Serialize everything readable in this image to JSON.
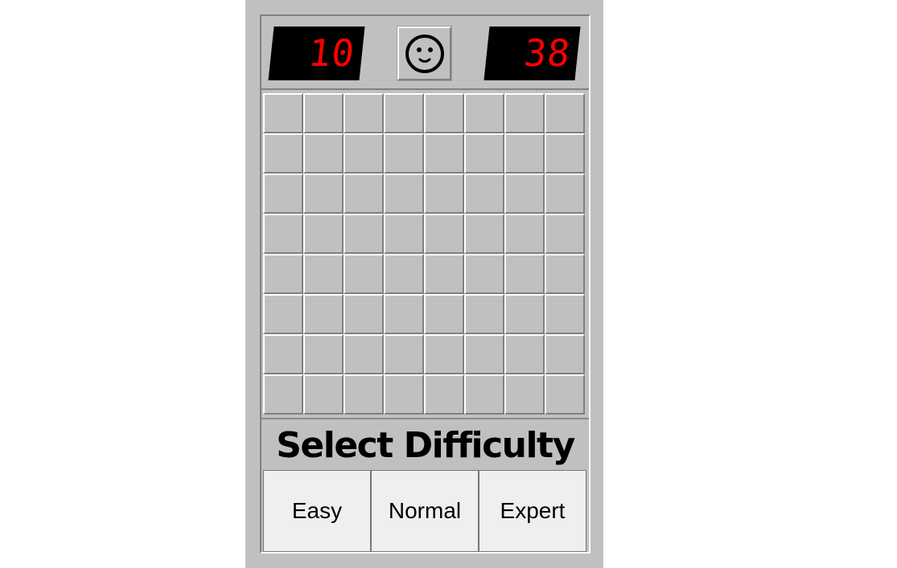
{
  "header": {
    "mine_counter": "10",
    "timer": "38",
    "face_icon": "smiley-face-icon"
  },
  "board": {
    "rows": 8,
    "cols": 8,
    "state": "all-unrevealed"
  },
  "difficulty": {
    "title": "Select Difficulty",
    "options": [
      "Easy",
      "Normal",
      "Expert"
    ]
  },
  "colors": {
    "panel": "#c0c0c0",
    "counter_bg": "#000000",
    "counter_digits": "#ff0000",
    "button_bg": "#efefef"
  }
}
